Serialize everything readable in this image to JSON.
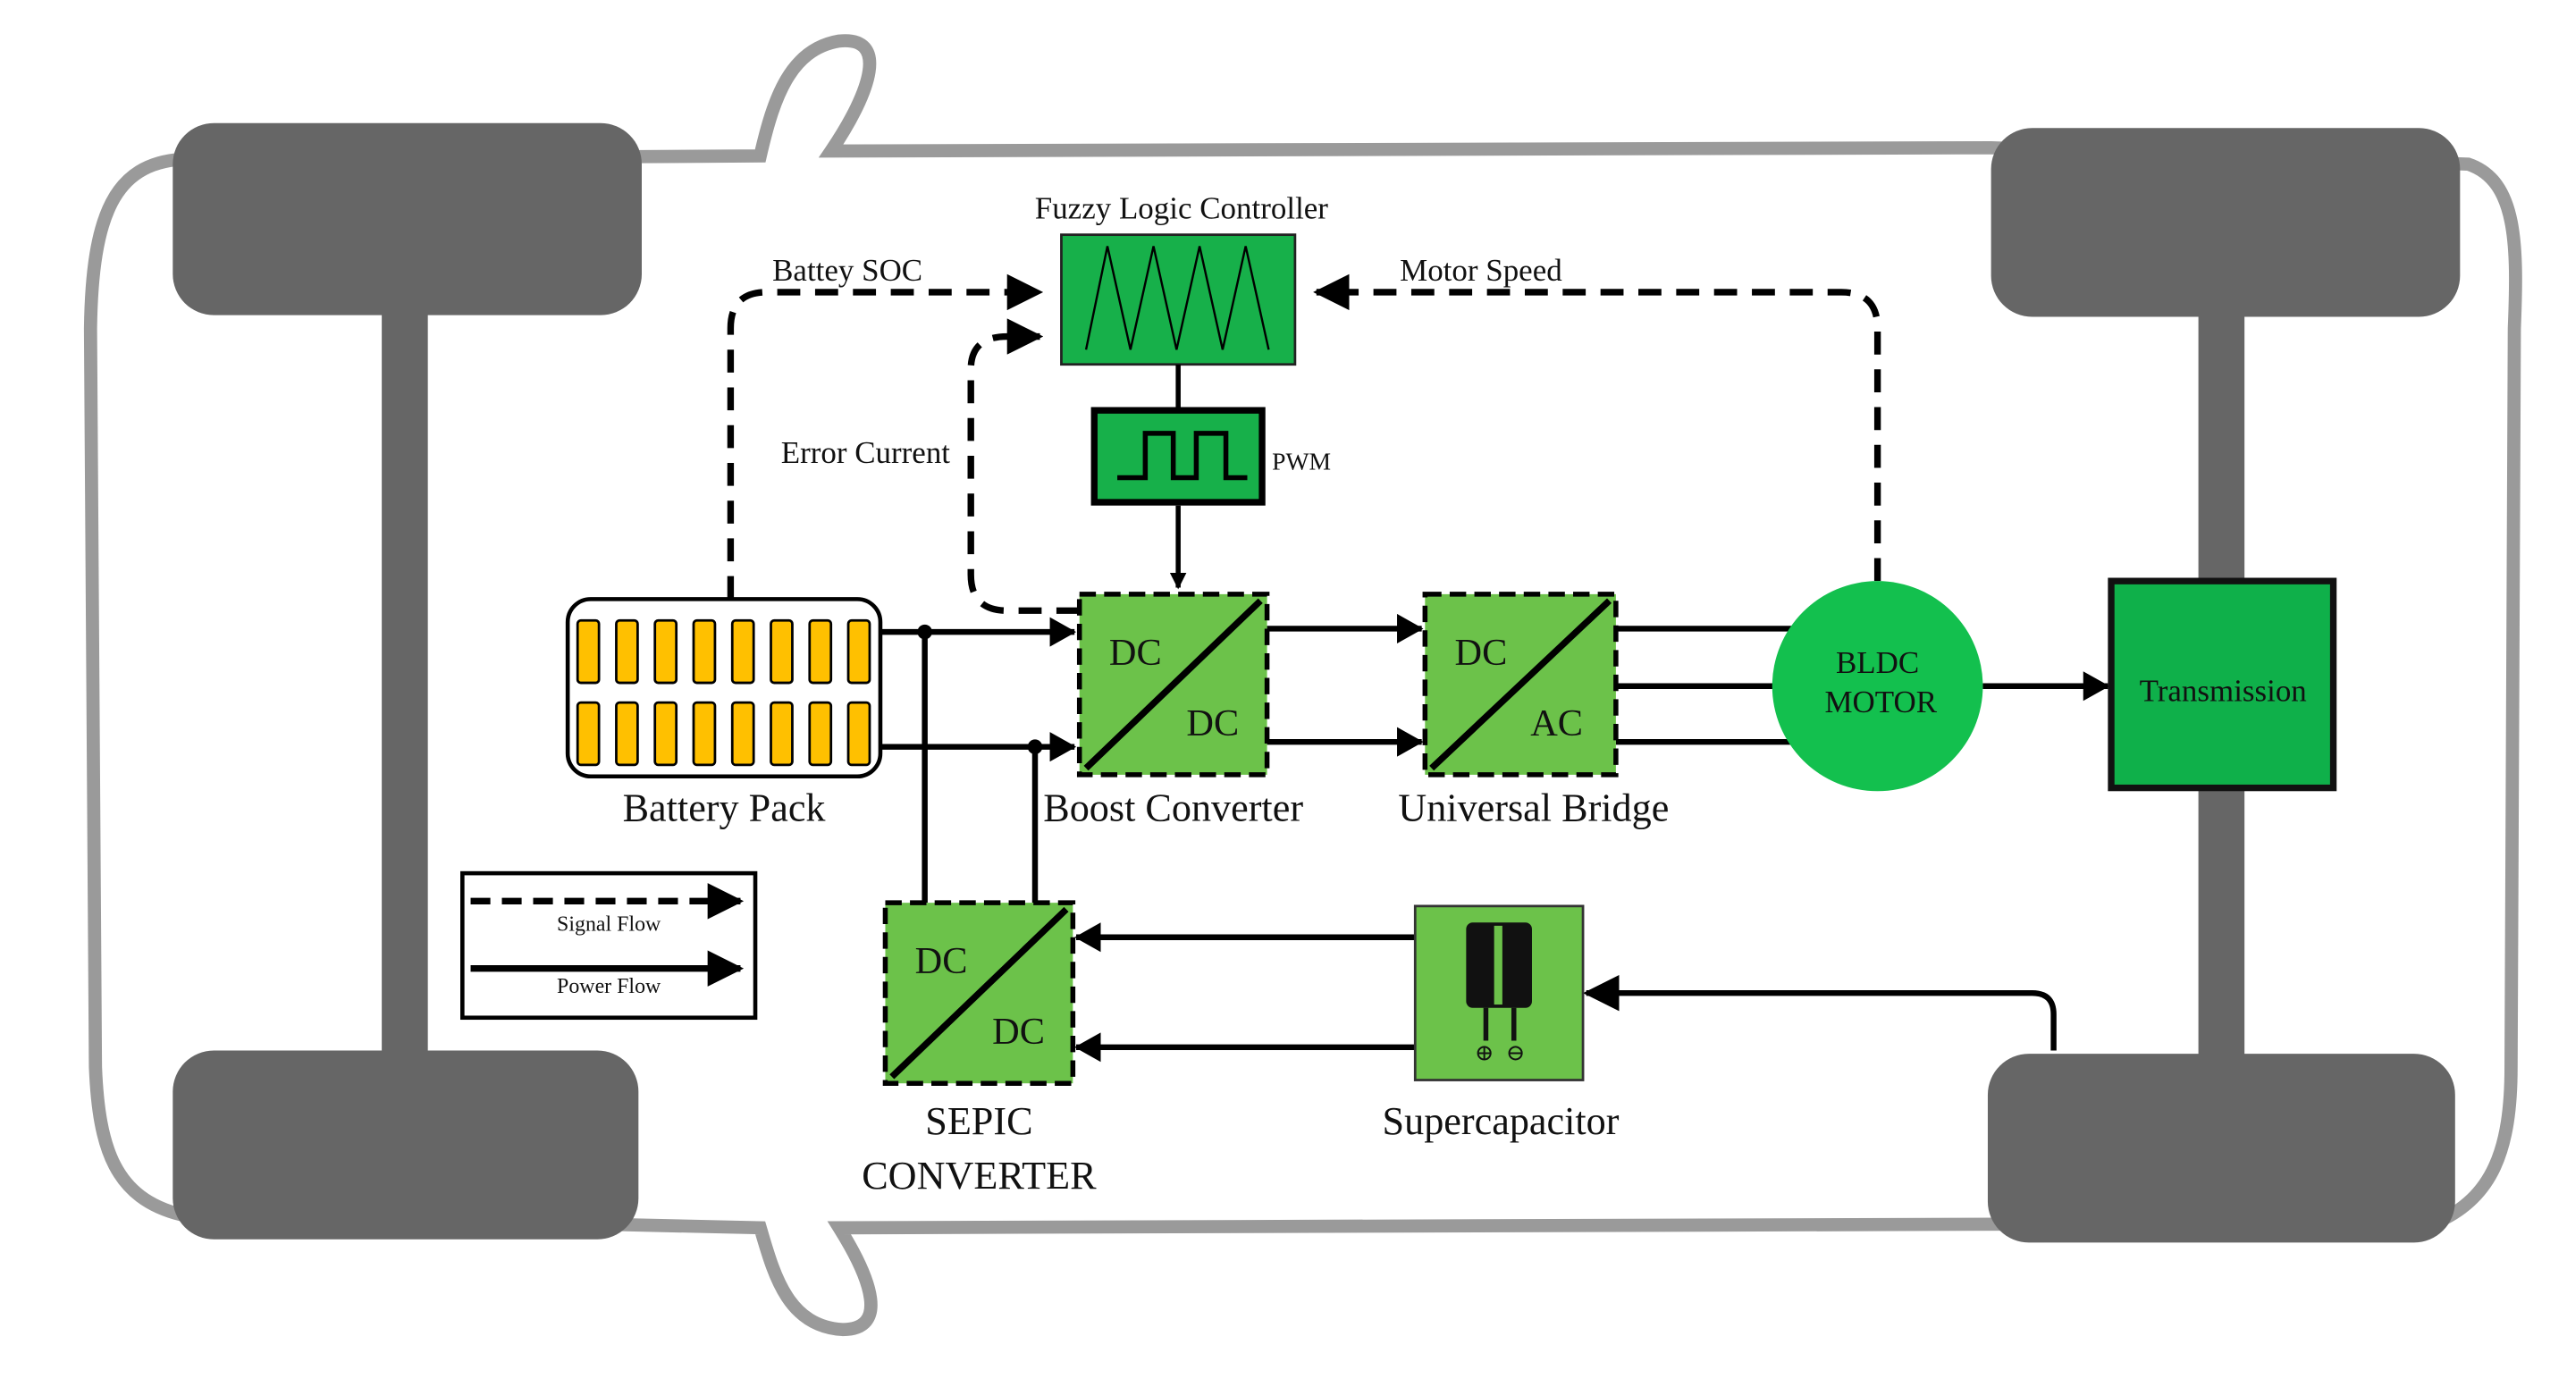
{
  "labels": {
    "controller": "Fuzzy Logic Controller",
    "battery_soc": "Battey SOC",
    "motor_speed": "Motor Speed",
    "error_current": "Error Current",
    "pwm": "PWM",
    "battery_pack": "Battery Pack",
    "boost_converter": "Boost Converter",
    "universal_bridge": "Universal Bridge",
    "sepic_line1": "SEPIC",
    "sepic_line2": "CONVERTER",
    "supercapacitor": "Supercapacitor",
    "transmission": "Transmission",
    "motor_line1": "BLDC",
    "motor_line2": "MOTOR"
  },
  "converters": {
    "boost": {
      "in": "DC",
      "out": "DC"
    },
    "bridge": {
      "in": "DC",
      "out": "AC"
    },
    "sepic": {
      "in": "DC",
      "out": "DC"
    }
  },
  "legend": {
    "signal": "Signal Flow",
    "power": "Power Flow"
  },
  "colors": {
    "controller_green": "#17b04a",
    "converter_green": "#6cc24a",
    "motor_green": "#13c04e",
    "battery_cell": "#ffc000",
    "wheel": "#666666",
    "chassis": "#9a9a9a"
  }
}
